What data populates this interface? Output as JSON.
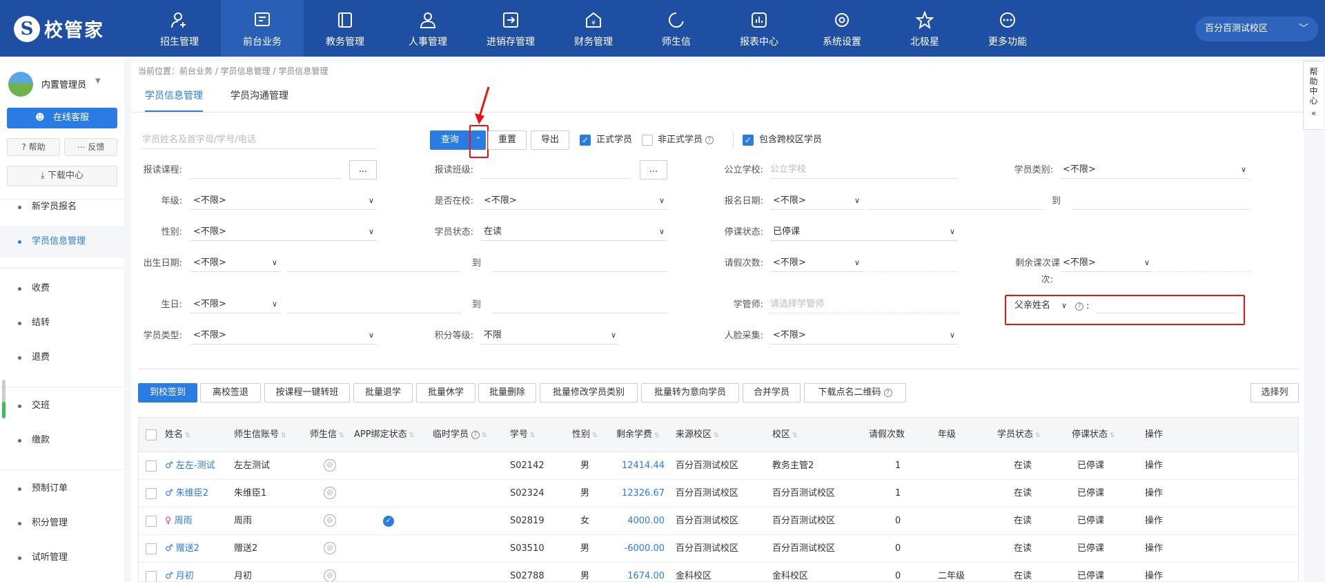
{
  "brand": {
    "logo_text": "校管家"
  },
  "nav": {
    "items": [
      {
        "label": "招生管理",
        "icon": "user-plus-icon"
      },
      {
        "label": "前台业务",
        "icon": "front-desk-icon"
      },
      {
        "label": "教务管理",
        "icon": "book-icon"
      },
      {
        "label": "人事管理",
        "icon": "person-icon"
      },
      {
        "label": "进销存管理",
        "icon": "inventory-icon"
      },
      {
        "label": "财务管理",
        "icon": "finance-icon"
      },
      {
        "label": "师生信",
        "icon": "message-icon"
      },
      {
        "label": "报表中心",
        "icon": "report-icon"
      },
      {
        "label": "系统设置",
        "icon": "gear-icon"
      },
      {
        "label": "北极星",
        "icon": "star-icon"
      },
      {
        "label": "更多功能",
        "icon": "more-icon"
      }
    ],
    "active_index": 1,
    "campus": "百分百测试校区"
  },
  "sidebar": {
    "username": "内置管理员",
    "online_service": "在线客服",
    "help": "帮助",
    "feedback": "反馈",
    "download_center": "下载中心",
    "items": [
      "新学员报名",
      "学员信息管理",
      "收费",
      "结转",
      "退费",
      "交班",
      "缴款",
      "预制订单",
      "积分管理",
      "试听管理"
    ],
    "active_index": 1
  },
  "breadcrumb": "当前位置：前台业务 / 学员信息管理 / 学员信息管理",
  "tabs": [
    "学员信息管理",
    "学员沟通管理"
  ],
  "help_center": "帮助中心",
  "search": {
    "placeholder": "学员姓名及首字母/学号/电话",
    "query_button": "查询",
    "collapse_icon": "chevron-up-icon",
    "reset_button": "重置",
    "export_button": "导出",
    "formal_label": "正式学员",
    "informal_label": "非正式学员",
    "cross_campus_label": "包含跨校区学员",
    "formal_checked": true,
    "informal_checked": false,
    "cross_campus_checked": true
  },
  "filters": {
    "course_label": "报读课程:",
    "course_btn": "...",
    "class_label": "报读班级:",
    "class_btn": "...",
    "public_school_label": "公立学校:",
    "public_school_placeholder": "公立学校",
    "student_category_label": "学员类别:",
    "student_category_value": "<不限>",
    "grade_label": "年级:",
    "grade_value": "<不限>",
    "in_school_label": "是否在校:",
    "in_school_value": "<不限>",
    "signup_date_label": "报名日期:",
    "signup_date_value": "<不限>",
    "to": "到",
    "gender_label": "性别:",
    "gender_value": "<不限>",
    "status_label": "学员状态:",
    "status_value": "在读",
    "suspend_label": "停课状态:",
    "suspend_value": "已停课",
    "birth_date_label": "出生日期:",
    "birth_date_value": "<不限>",
    "leave_label": "请假次数:",
    "leave_value": "<不限>",
    "remaining_label_1": "剩余课次课",
    "remaining_label_2": "次:",
    "remaining_value": "<不限>",
    "birthday_label": "生日:",
    "birthday_value": "<不限>",
    "advisor_label": "学管师:",
    "advisor_placeholder": "请选择学管师",
    "father_name_select": "父亲姓名",
    "colon": ":",
    "student_type_label": "学员类型:",
    "student_type_value": "<不限>",
    "points_label": "积分等级:",
    "points_value": "不限",
    "face_label": "人脸采集:",
    "face_value": "<不限>"
  },
  "toolbar": {
    "buttons": [
      "到校签到",
      "离校签退",
      "按课程一键转班",
      "批量退学",
      "批量休学",
      "批量删除",
      "批量修改学员类别",
      "批量转为意向学员",
      "合并学员",
      "下载点名二维码"
    ],
    "select_columns": "选择列"
  },
  "table": {
    "headers": [
      "姓名",
      "师生信账号",
      "师生信",
      "APP绑定状态",
      "临时学员",
      "学号",
      "性别",
      "剩余学费",
      "来源校区",
      "校区",
      "请假次数",
      "年级",
      "学员状态",
      "停课状态",
      "操作"
    ],
    "rows": [
      {
        "name": "左左-测试",
        "sex_icon": "♂",
        "account": "左左测试",
        "bound": false,
        "id": "S02142",
        "gender": "男",
        "fee": "12414.44",
        "source": "百分百测试校区",
        "campus": "教务主管2",
        "leave": "1",
        "grade": "",
        "status": "在读",
        "suspend": "已停课",
        "op": "操作"
      },
      {
        "name": "朱维臣2",
        "sex_icon": "♂",
        "account": "朱维臣1",
        "bound": false,
        "id": "S02324",
        "gender": "男",
        "fee": "12326.67",
        "source": "百分百测试校区",
        "campus": "百分百测试校区",
        "leave": "1",
        "grade": "",
        "status": "在读",
        "suspend": "已停课",
        "op": "操作"
      },
      {
        "name": "周雨",
        "sex_icon": "♀",
        "account": "周雨",
        "bound": true,
        "id": "S02819",
        "gender": "女",
        "fee": "4000.00",
        "source": "百分百测试校区",
        "campus": "百分百测试校区",
        "leave": "0",
        "grade": "",
        "status": "在读",
        "suspend": "已停课",
        "op": "操作"
      },
      {
        "name": "赠送2",
        "sex_icon": "♂",
        "account": "赠送2",
        "bound": false,
        "id": "S03510",
        "gender": "男",
        "fee": "-6000.00",
        "source": "百分百测试校区",
        "campus": "百分百测试校区",
        "leave": "0",
        "grade": "",
        "status": "在读",
        "suspend": "已停课",
        "op": "操作"
      },
      {
        "name": "月初",
        "sex_icon": "♂",
        "account": "月初",
        "bound": false,
        "id": "S02788",
        "gender": "男",
        "fee": "1674.00",
        "source": "金科校区",
        "campus": "金科校区",
        "leave": "0",
        "grade": "二年级",
        "status": "在读",
        "suspend": "已停课",
        "op": "操作"
      }
    ]
  },
  "colors": {
    "nav_bg": "#1e4fa3",
    "accent": "#2b7be5",
    "highlight": "#e11111"
  }
}
